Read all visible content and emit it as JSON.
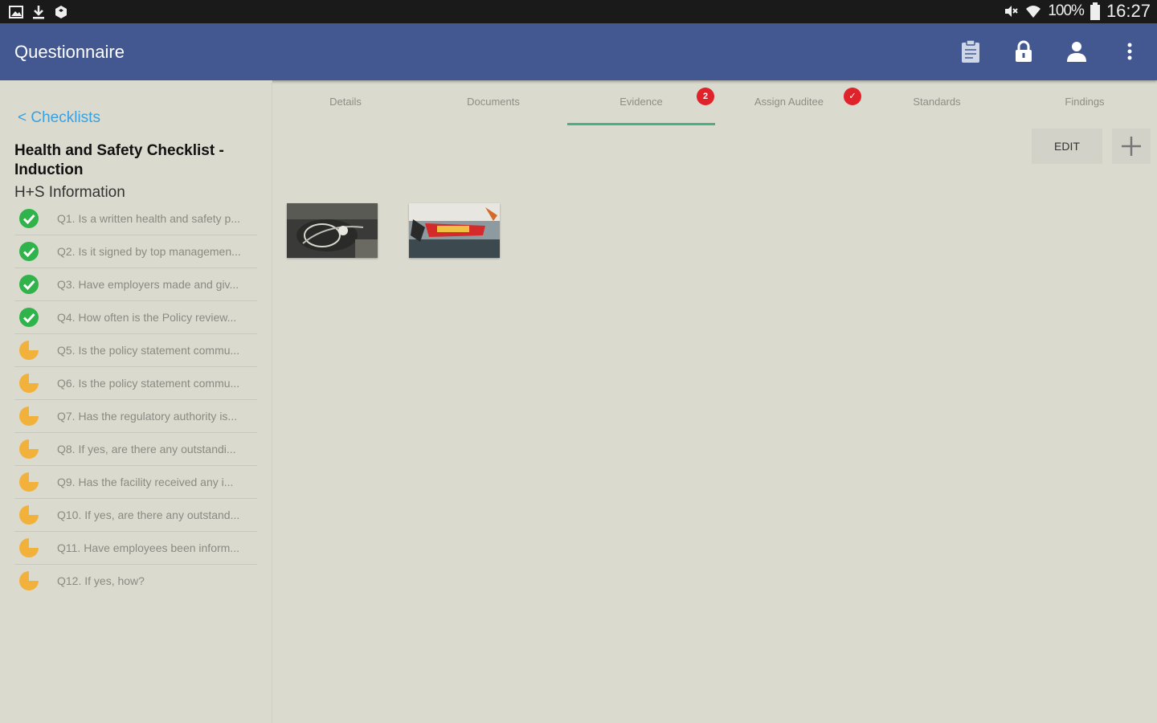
{
  "status_bar": {
    "battery": "100%",
    "time": "16:27",
    "left_icons": [
      "gallery-icon",
      "download-icon",
      "dropbox-icon"
    ],
    "right_icons": [
      "mute-icon",
      "wifi-icon",
      "battery-icon"
    ]
  },
  "app_bar": {
    "title": "Questionnaire",
    "actions": [
      "clipboard-icon",
      "lock-icon",
      "person-icon",
      "overflow-menu-icon"
    ],
    "color": "#435890"
  },
  "sidebar": {
    "back_label": "< Checklists",
    "checklist_title": "Health and Safety Checklist - Induction",
    "section_title": "H+S Information",
    "questions": [
      {
        "label": "Q1. Is a written health and safety p...",
        "status": "complete"
      },
      {
        "label": "Q2. Is it signed by top managemen...",
        "status": "complete"
      },
      {
        "label": "Q3. Have employers made and giv...",
        "status": "complete"
      },
      {
        "label": "Q4. How often is the Policy review...",
        "status": "complete"
      },
      {
        "label": "Q5. Is the policy statement commu...",
        "status": "partial"
      },
      {
        "label": "Q6. Is the policy statement commu...",
        "status": "partial"
      },
      {
        "label": "Q7. Has the regulatory authority is...",
        "status": "partial"
      },
      {
        "label": "Q8. If yes, are there any outstandi...",
        "status": "partial"
      },
      {
        "label": "Q9. Has the facility received any i...",
        "status": "partial"
      },
      {
        "label": "Q10. If yes, are there any outstand...",
        "status": "partial"
      },
      {
        "label": "Q11. Have employees been inform...",
        "status": "partial"
      },
      {
        "label": "Q12. If yes, how?",
        "status": "partial"
      }
    ]
  },
  "tabs": [
    {
      "label": "Details"
    },
    {
      "label": "Documents"
    },
    {
      "label": "Evidence",
      "active": true,
      "badge": "2"
    },
    {
      "label": "Assign Auditee",
      "badge": "✓"
    },
    {
      "label": "Standards"
    },
    {
      "label": "Findings"
    }
  ],
  "evidence": {
    "edit_label": "EDIT",
    "add_icon": "plus-icon",
    "thumbnails": [
      "evidence-photo-1",
      "evidence-photo-2"
    ]
  },
  "colors": {
    "accent": "#4caf8a",
    "complete": "#2fb34a",
    "partial": "#f2b13a",
    "badge": "#e0222a",
    "link": "#3aa0e0"
  }
}
